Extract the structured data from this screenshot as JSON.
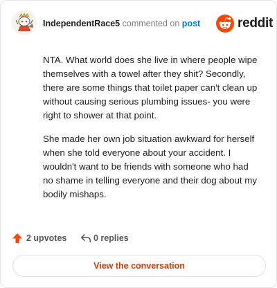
{
  "header": {
    "username": "IndependentRace5",
    "action_text": "commented on",
    "post_link_label": "post",
    "brand_name": "reddit",
    "brand_color": "#ff4500"
  },
  "comment": {
    "paragraphs": [
      "NTA. What world does she live in where people wipe themselves with a towel after they shit? Secondly, there are some things that toilet paper can't clean up without causing serious plumbing issues- you were right to shower at that point.",
      "She made her own job situation awkward for herself when she told everyone about your accident. I wouldn't want to be friends with someone who had no shame in telling everyone and their dog about my bodily mishaps."
    ]
  },
  "footer": {
    "upvotes_label": "2 upvotes",
    "replies_label": "0 replies",
    "upvote_icon": "upvote-arrow-icon",
    "reply_icon": "reply-arrow-icon",
    "upvote_color": "#ff4500"
  },
  "cta": {
    "label": "View the conversation",
    "color": "#d93a00"
  }
}
